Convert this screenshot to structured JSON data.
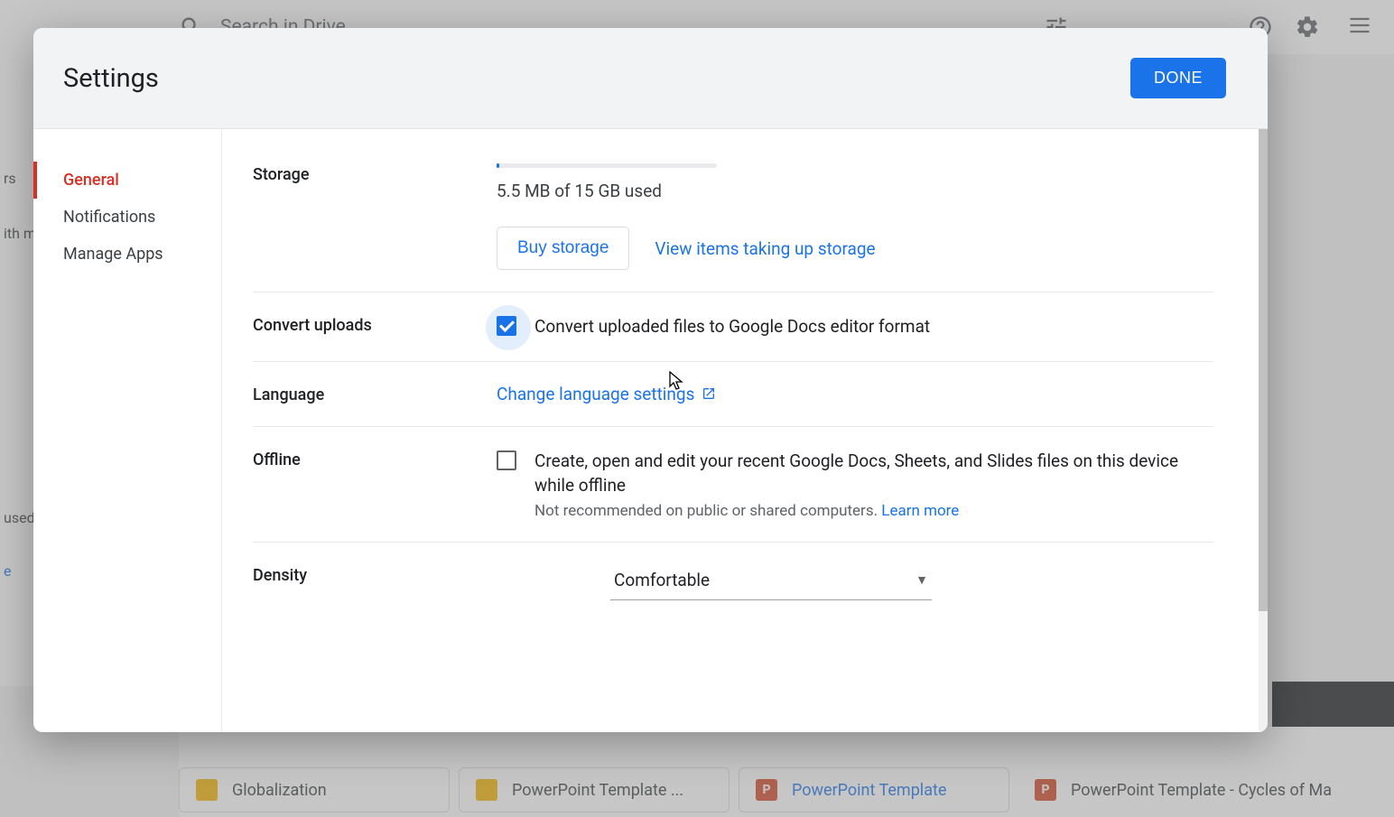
{
  "bg": {
    "search_placeholder": "Search in Drive",
    "sidebar": [
      "rs",
      "ith m",
      "used",
      "e"
    ],
    "files": [
      {
        "type": "slides",
        "name": "Globalization"
      },
      {
        "type": "slides",
        "name": "PowerPoint Template ..."
      },
      {
        "type": "ppt",
        "name": "PowerPoint Template",
        "highlight": true
      },
      {
        "type": "ppt",
        "name": "PowerPoint Template - Cycles of Ma"
      }
    ]
  },
  "dialog": {
    "title": "Settings",
    "done": "DONE",
    "nav": {
      "general": "General",
      "notifications": "Notifications",
      "manage_apps": "Manage Apps"
    },
    "storage": {
      "label": "Storage",
      "used_text": "5.5 MB of 15 GB used",
      "buy": "Buy storage",
      "view_items": "View items taking up storage"
    },
    "convert": {
      "label": "Convert uploads",
      "text": "Convert uploaded files to Google Docs editor format",
      "checked": true
    },
    "language": {
      "label": "Language",
      "link": "Change language settings"
    },
    "offline": {
      "label": "Offline",
      "text": "Create, open and edit your recent Google Docs, Sheets, and Slides files on this device while offline",
      "helper": "Not recommended on public or shared computers.",
      "learn_more": "Learn more",
      "checked": false
    },
    "density": {
      "label": "Density",
      "value": "Comfortable"
    }
  }
}
